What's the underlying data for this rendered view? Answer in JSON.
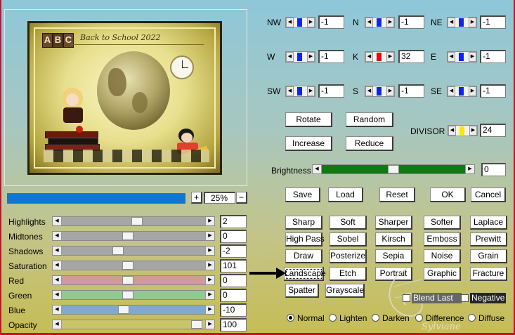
{
  "preview": {
    "header_text": "Back to School 2022",
    "letters": [
      "A",
      "B",
      "C"
    ],
    "clock_alt": "pocket watch",
    "zoom_value": "25%",
    "zoom_plus": "+",
    "zoom_minus": "−"
  },
  "matrix": {
    "labels": {
      "nw": "NW",
      "n": "N",
      "ne": "NE",
      "w": "W",
      "k": "K",
      "e": "E",
      "sw": "SW",
      "s": "S",
      "se": "SE"
    },
    "values": {
      "nw": "-1",
      "n": "-1",
      "ne": "-1",
      "w": "-1",
      "k": "32",
      "e": "-1",
      "sw": "-1",
      "s": "-1",
      "se": "-1"
    }
  },
  "controls": {
    "rotate": "Rotate",
    "random": "Random",
    "increase": "Increase",
    "reduce": "Reduce",
    "divisor_label": "DIVISOR",
    "divisor_value": "24",
    "brightness_label": "Brightness",
    "brightness_value": "0",
    "save": "Save",
    "load": "Load",
    "reset": "Reset",
    "ok": "OK",
    "cancel": "Cancel"
  },
  "presets": [
    "Sharp",
    "Soft",
    "Sharper",
    "Softer",
    "Laplace",
    "High Pass",
    "Sobel",
    "Kirsch",
    "Emboss",
    "Prewitt",
    "Draw",
    "Posterize",
    "Sepia",
    "Noise",
    "Grain",
    "Landscape",
    "Etch",
    "Portrait",
    "Graphic",
    "Fracture",
    "Spatter",
    "Grayscale"
  ],
  "options": {
    "blend_last": "Blend Last",
    "negative": "Negative"
  },
  "blend_modes": [
    "Normal",
    "Lighten",
    "Darken",
    "Difference",
    "Diffuse"
  ],
  "adjustments": [
    {
      "label": "Highlights",
      "value": "2",
      "level": 0.52,
      "color": "#a6a6a6"
    },
    {
      "label": "Midtones",
      "value": "0",
      "level": 0.45,
      "color": "#a6a6a6"
    },
    {
      "label": "Shadows",
      "value": "-2",
      "level": 0.38,
      "color": "#a6a6a6"
    },
    {
      "label": "Saturation",
      "value": "101",
      "level": 0.45,
      "color": "#a6a6a6"
    },
    {
      "label": "Red",
      "value": "0",
      "level": 0.45,
      "color": "#cf9a9a"
    },
    {
      "label": "Green",
      "value": "0",
      "level": 0.45,
      "color": "#92c98e"
    },
    {
      "label": "Blue",
      "value": "-10",
      "level": 0.42,
      "color": "#80a9cc"
    },
    {
      "label": "Opacity",
      "value": "100",
      "level": 0.97,
      "color": "#c8c46a"
    }
  ],
  "watermark": "Sylviane"
}
